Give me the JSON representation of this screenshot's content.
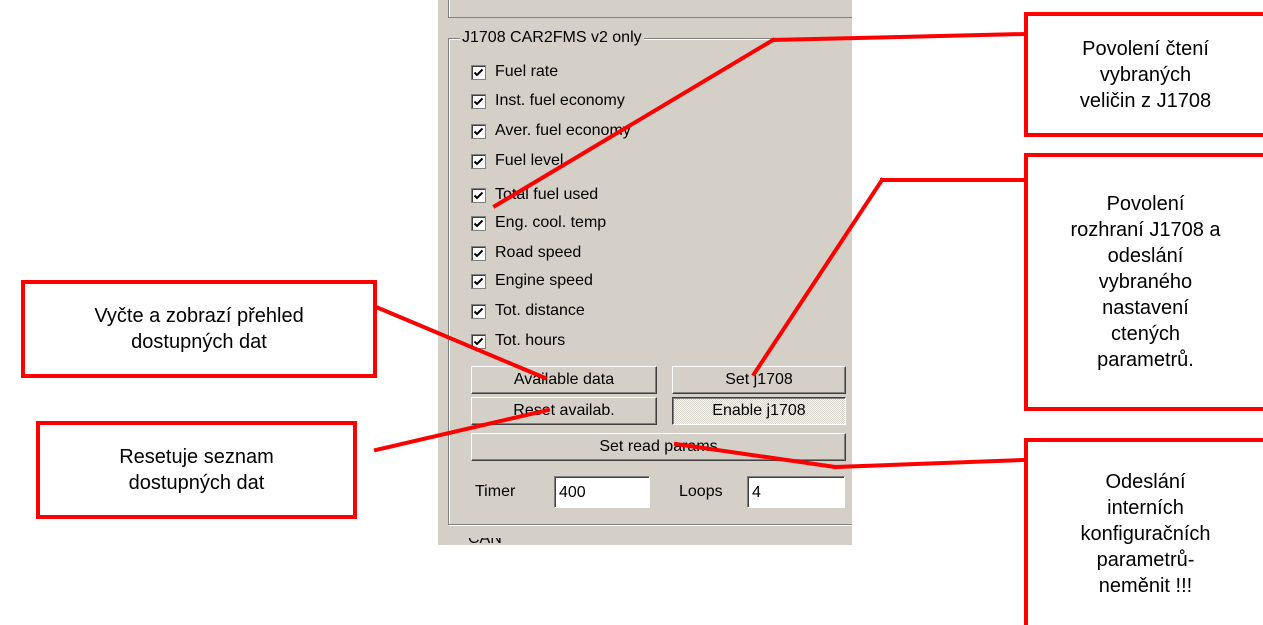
{
  "group_title": "J1708 CAR2FMS v2 only",
  "checkboxes": [
    {
      "label": "Fuel rate",
      "checked": true
    },
    {
      "label": "Inst. fuel economy",
      "checked": true
    },
    {
      "label": "Aver. fuel economy",
      "checked": true
    },
    {
      "label": "Fuel level",
      "checked": true
    },
    {
      "label": "Total fuel used",
      "checked": true
    },
    {
      "label": "Eng. cool. temp",
      "checked": true
    },
    {
      "label": "Road speed",
      "checked": true
    },
    {
      "label": "Engine speed",
      "checked": true
    },
    {
      "label": "Tot. distance",
      "checked": true
    },
    {
      "label": "Tot. hours",
      "checked": true
    }
  ],
  "buttons": {
    "available_data": "Available data",
    "set_j1708": "Set j1708",
    "reset_available": "Reset availab.",
    "enable_j1708": "Enable j1708",
    "set_read_params": "Set read params"
  },
  "timer": {
    "label": "Timer",
    "value": "400"
  },
  "loops": {
    "label": "Loops",
    "value": "4"
  },
  "bottom_partial_text": "CAN",
  "callouts": {
    "read_enable": "Povolení čtení\nvybraných\nveličin z J1708",
    "interface_enable": "Povolení\nrozhraní J1708 a\nodeslání\nvybraného\nnastavení\nctených\nparametrů.",
    "available_overview": "Vyčte a zobrazí přehled\ndostupných dat",
    "reset_list": "Resetuje seznam\ndostupných dat",
    "internal_config": "Odeslání\ninterních\nkonfiguračních\nparametrů-\nneměnit !!!"
  },
  "colors": {
    "callout_border": "#ff0000",
    "panel_bg": "#d4d0c8"
  }
}
